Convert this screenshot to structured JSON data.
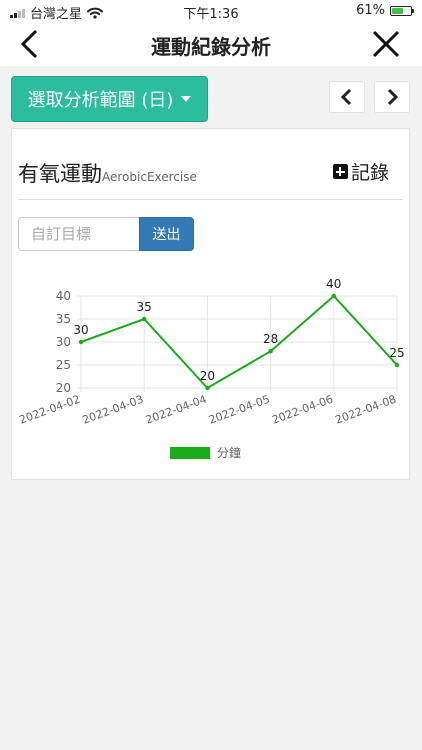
{
  "status_bar": {
    "carrier": "台灣之星",
    "time": "下午1:36",
    "battery": "61%",
    "battery_level": 0.61
  },
  "nav": {
    "title": "運動紀錄分析"
  },
  "range_selector": {
    "label": "選取分析範圍 (日)"
  },
  "card": {
    "title_zh": "有氧運動",
    "title_en": "AerobicExercise",
    "record_label": "記錄",
    "goal_input": {
      "placeholder": "自訂目標",
      "value": ""
    },
    "submit_label": "送出"
  },
  "chart_data": {
    "type": "line",
    "categories": [
      "2022-04-02",
      "2022-04-03",
      "2022-04-04",
      "2022-04-05",
      "2022-04-06",
      "2022-04-08"
    ],
    "series": [
      {
        "name": "分鐘",
        "values": [
          30,
          35,
          20,
          28,
          40,
          25
        ],
        "color": "#1aab1a"
      }
    ],
    "yticks": [
      20,
      25,
      30,
      35,
      40
    ],
    "ylim": [
      20,
      40
    ],
    "grid": true,
    "data_labels": true,
    "legend_position": "bottom"
  }
}
